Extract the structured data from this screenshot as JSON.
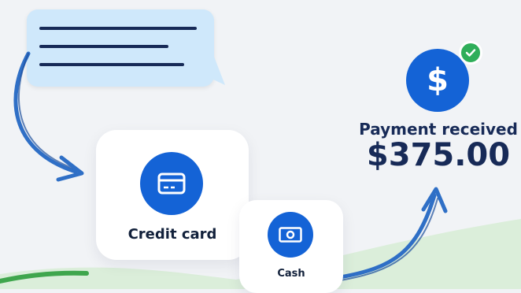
{
  "payment_methods": {
    "credit_card": {
      "label": "Credit card",
      "icon": "credit-card-icon"
    },
    "cash": {
      "label": "Cash",
      "icon": "cash-icon"
    }
  },
  "payment_status": {
    "title": "Payment received",
    "amount": "$375.00",
    "currency_symbol": "$",
    "badge_icon": "check-icon"
  },
  "colors": {
    "accent_blue": "#1463d6",
    "navy_text": "#172a57",
    "bubble_blue": "#cfe8fb",
    "success_green": "#2fae5a",
    "background": "#f1f3f6"
  }
}
